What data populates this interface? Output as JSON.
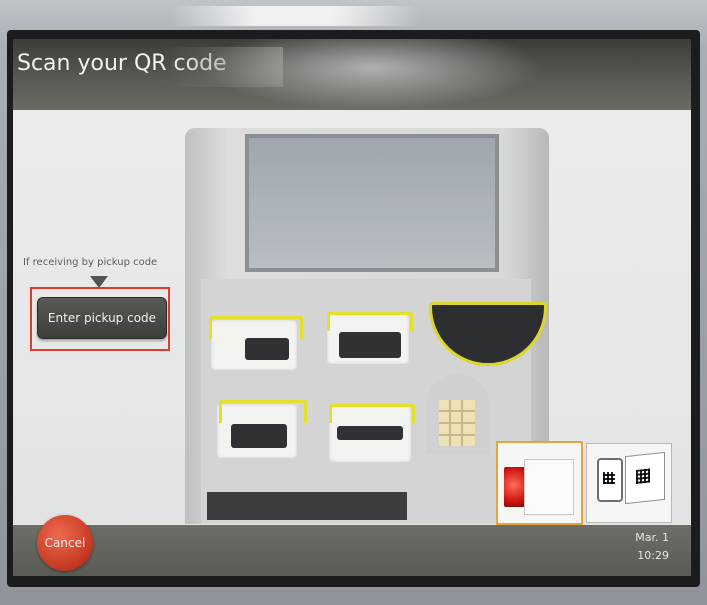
{
  "header": {
    "title": "Scan your QR code"
  },
  "main": {
    "hint": "If receiving by pickup code",
    "pickup_button_label": "Enter pickup code"
  },
  "footer": {
    "cancel_label": "Cancel",
    "date": "Mar. 1",
    "time": "10:29"
  },
  "colors": {
    "highlight": "#e23b2c",
    "accent_yellow": "#e3df2a",
    "cancel": "#c83b24",
    "selected_tile": "#e7a33c"
  }
}
